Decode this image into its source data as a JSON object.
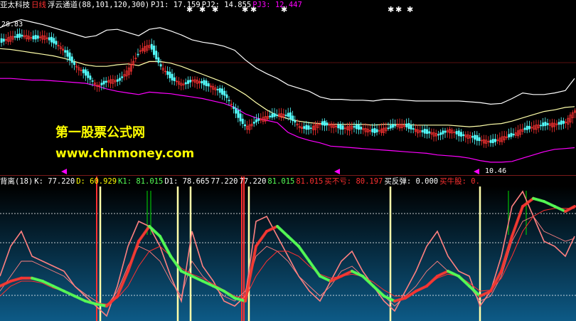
{
  "colors": {
    "white": "#ffffff",
    "yellow": "#ffff00",
    "red": "#ff3030",
    "magenta": "#ff00ff",
    "green": "#00e000",
    "lime": "#55ff55",
    "cream": "#ffffaa",
    "pink": "#ff8080",
    "grey": "#c0c0c0",
    "gradient_top": "#000000",
    "gradient_bottom": "#0d5a86"
  },
  "upper_header": {
    "stock": "亚太科技",
    "period": "日线",
    "indicator": "浮云通道(88,101,120,300)",
    "pj1": "PJ1: 17.159",
    "pj2": "PJ2: 14.855",
    "pj3": "PJ3: 12.447"
  },
  "lower_header": {
    "name": "背离(18)",
    "k": "K: 77.220",
    "d": "D: 60.929",
    "k1": "K1: 81.015",
    "d1": "D1: 78.665",
    "v1": "77.220",
    "v2": "77.220",
    "v3": "81.015",
    "v4": "81.015",
    "buy_no_loss": "买不亏: 80.197",
    "buy_rebound": "买反弹: 0.000",
    "buy_bull": "买牛股: 0."
  },
  "price_high_label": "28.83",
  "price_low_label": "10.46",
  "watermark": {
    "line1": "第一股票公式网",
    "line2": "www.chnmoney.com"
  },
  "chart_data": [
    {
      "type": "line",
      "title": "浮云通道(88,101,120,300)",
      "x": [
        0,
        15,
        30,
        45,
        60,
        75,
        90,
        105,
        120,
        135,
        150,
        165,
        180,
        195,
        210,
        225,
        240,
        255,
        270,
        285,
        300,
        315,
        330,
        345,
        360,
        375,
        390,
        405,
        420,
        435,
        450,
        465,
        480,
        495,
        510,
        525,
        540,
        555,
        570,
        585,
        600,
        615,
        630,
        645,
        660,
        675,
        690,
        705,
        720,
        735,
        750,
        765,
        780,
        795,
        808
      ],
      "series": [
        {
          "name": "upper",
          "values": [
            27.8,
            28.4,
            28.8,
            28.5,
            28.2,
            27.8,
            27.4,
            27.0,
            26.6,
            26.8,
            27.5,
            27.6,
            27.2,
            26.8,
            27.6,
            27.8,
            27.4,
            26.9,
            26.3,
            26.0,
            25.8,
            25.5,
            25.0,
            23.8,
            22.8,
            22.1,
            21.5,
            20.7,
            20.3,
            19.9,
            19.2,
            18.9,
            18.9,
            18.8,
            18.8,
            18.7,
            18.9,
            18.9,
            18.8,
            18.7,
            18.7,
            18.7,
            18.7,
            18.7,
            18.6,
            18.5,
            18.3,
            18.4,
            19.0,
            19.7,
            19.5,
            19.5,
            19.7,
            20.0,
            21.5
          ]
        },
        {
          "name": "middle",
          "values": [
            25.2,
            25.1,
            24.9,
            24.7,
            24.5,
            24.3,
            24.0,
            23.6,
            23.2,
            23.0,
            23.0,
            23.2,
            23.3,
            23.1,
            23.6,
            23.6,
            23.4,
            23.0,
            22.5,
            22.0,
            21.5,
            21.0,
            20.3,
            19.5,
            18.5,
            17.6,
            16.9,
            16.5,
            16.2,
            16.0,
            15.9,
            15.8,
            15.8,
            15.8,
            15.8,
            15.7,
            15.8,
            15.8,
            15.8,
            15.7,
            15.7,
            15.7,
            15.7,
            15.6,
            15.5,
            15.6,
            15.8,
            15.9,
            16.2,
            16.6,
            17.0,
            17.4,
            17.6,
            17.9,
            18.0
          ]
        },
        {
          "name": "lower",
          "values": [
            21.5,
            21.5,
            21.4,
            21.3,
            21.3,
            21.2,
            21.1,
            21.0,
            20.9,
            20.6,
            20.2,
            19.9,
            19.7,
            19.5,
            19.8,
            19.7,
            19.6,
            19.4,
            19.2,
            19.0,
            18.7,
            18.4,
            17.9,
            17.1,
            16.6,
            16.3,
            16.0,
            14.8,
            14.2,
            13.8,
            13.5,
            13.1,
            13.0,
            12.9,
            12.8,
            12.7,
            12.6,
            12.5,
            12.4,
            12.3,
            12.2,
            12.0,
            11.9,
            11.8,
            11.6,
            11.3,
            11.1,
            11.1,
            11.2,
            11.6,
            12.0,
            12.4,
            12.7,
            12.8,
            12.9
          ]
        },
        {
          "name": "price",
          "values": [
            26.1,
            26.6,
            26.8,
            26.5,
            26.7,
            26.0,
            24.8,
            23.0,
            22.0,
            20.5,
            21.2,
            21.2,
            22.6,
            25.0,
            25.6,
            22.9,
            21.5,
            20.7,
            21.3,
            20.9,
            20.3,
            19.5,
            17.3,
            15.3,
            16.3,
            16.7,
            17.0,
            16.9,
            15.4,
            15.3,
            15.9,
            15.7,
            15.3,
            15.5,
            15.2,
            14.9,
            15.2,
            15.7,
            15.6,
            15.0,
            14.8,
            14.5,
            15.1,
            14.5,
            14.3,
            13.8,
            13.6,
            14.1,
            14.5,
            15.2,
            15.5,
            15.8,
            15.8,
            16.1,
            17.6
          ]
        }
      ],
      "ylim": [
        9.5,
        30
      ]
    },
    {
      "type": "line",
      "title": "背离(18)",
      "x": [
        0,
        15,
        30,
        45,
        60,
        75,
        90,
        105,
        120,
        135,
        150,
        165,
        180,
        195,
        210,
        225,
        240,
        255,
        270,
        285,
        300,
        315,
        330,
        345,
        360,
        375,
        390,
        405,
        420,
        435,
        450,
        465,
        480,
        495,
        510,
        525,
        540,
        555,
        570,
        585,
        600,
        615,
        630,
        645,
        660,
        675,
        690,
        705,
        720,
        735,
        750,
        765,
        780,
        795,
        808
      ],
      "series": [
        {
          "name": "K",
          "values": [
            40,
            70,
            85,
            60,
            55,
            50,
            45,
            30,
            20,
            10,
            0,
            30,
            70,
            95,
            90,
            70,
            40,
            15,
            85,
            50,
            35,
            15,
            10,
            20,
            95,
            100,
            80,
            60,
            40,
            25,
            15,
            35,
            55,
            65,
            45,
            30,
            15,
            5,
            25,
            45,
            70,
            85,
            60,
            45,
            40,
            10,
            25,
            60,
            110,
            125,
            100,
            75,
            70,
            60,
            80
          ]
        },
        {
          "name": "D",
          "values": [
            25,
            40,
            55,
            55,
            50,
            45,
            40,
            30,
            22,
            15,
            10,
            25,
            50,
            70,
            65,
            55,
            35,
            20,
            55,
            40,
            30,
            20,
            15,
            25,
            60,
            70,
            65,
            55,
            40,
            30,
            20,
            30,
            45,
            50,
            40,
            30,
            20,
            10,
            20,
            30,
            45,
            55,
            45,
            40,
            30,
            15,
            20,
            40,
            75,
            95,
            100,
            85,
            80,
            75,
            78
          ]
        },
        {
          "name": "K1",
          "values": [
            30,
            35,
            38,
            38,
            35,
            30,
            25,
            20,
            15,
            12,
            10,
            20,
            45,
            75,
            90,
            80,
            60,
            45,
            40,
            35,
            30,
            25,
            18,
            15,
            70,
            85,
            90,
            80,
            70,
            55,
            40,
            35,
            40,
            45,
            40,
            30,
            20,
            15,
            18,
            25,
            30,
            40,
            45,
            40,
            30,
            20,
            25,
            45,
            80,
            110,
            118,
            115,
            110,
            105,
            110
          ]
        },
        {
          "name": "D1",
          "values": [
            20,
            30,
            35,
            35,
            33,
            28,
            25,
            20,
            16,
            13,
            12,
            18,
            30,
            50,
            65,
            70,
            60,
            48,
            42,
            38,
            32,
            26,
            20,
            18,
            40,
            55,
            65,
            65,
            60,
            50,
            42,
            38,
            40,
            42,
            40,
            34,
            26,
            20,
            20,
            24,
            30,
            38,
            42,
            40,
            33,
            25,
            26,
            38,
            60,
            85,
            100,
            106,
            108,
            108,
            108
          ]
        }
      ],
      "ylim": [
        -5,
        130
      ]
    }
  ]
}
